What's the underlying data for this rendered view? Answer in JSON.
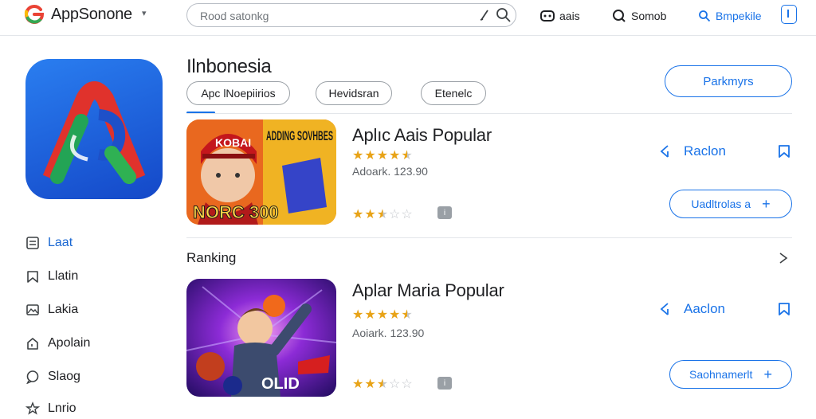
{
  "topbar": {
    "brand": "AppSonone",
    "search_placeholder": "Rood satonkg",
    "nav_1": "aais",
    "nav_2": "Somob",
    "nav_3": "Bmpekile"
  },
  "hero": {
    "icon": "app-logo-icon"
  },
  "sidebar": {
    "items": [
      {
        "label": "Laat",
        "icon": "list-icon"
      },
      {
        "label": "Llatin",
        "icon": "bookmark-icon"
      },
      {
        "label": "Lakia",
        "icon": "image-icon"
      },
      {
        "label": "Apolain",
        "icon": "home-icon"
      },
      {
        "label": "Slaog",
        "icon": "chat-icon"
      },
      {
        "label": "Lnrio",
        "icon": "star-icon"
      }
    ]
  },
  "header": {
    "country": "Ilnbonesia",
    "tabs": [
      "Apc lNoepiirios",
      "Hevidsran",
      "Etenelc"
    ],
    "primary_button": "Parkmyrs"
  },
  "apps": [
    {
      "title": "Aplıc Aais Popular",
      "rating_top": 4.5,
      "meta": "Adoark. 123.90",
      "rating_bottom": 2.5,
      "badge": "i",
      "action_label": "Raclon",
      "pill_label": "Uadltrolas a",
      "thumb_text_top": "ADDING SOVHBES",
      "thumb_text_badge": "KOBAI",
      "thumb_text_bottom": "NORC 300"
    },
    {
      "title": "Aplar Maria Popular",
      "rating_top": 4.5,
      "meta": "Aoiark. 123.90",
      "rating_bottom": 2.5,
      "badge": "i",
      "action_label": "Aaclon",
      "pill_label": "Saohnamerlt",
      "thumb_text_bottom": "OLID"
    }
  ],
  "ranking": {
    "title": "Ranking"
  },
  "colors": {
    "accent": "#1a73e8",
    "star": "#e8a317",
    "hero_icon_bg": "#1f5fdc"
  }
}
